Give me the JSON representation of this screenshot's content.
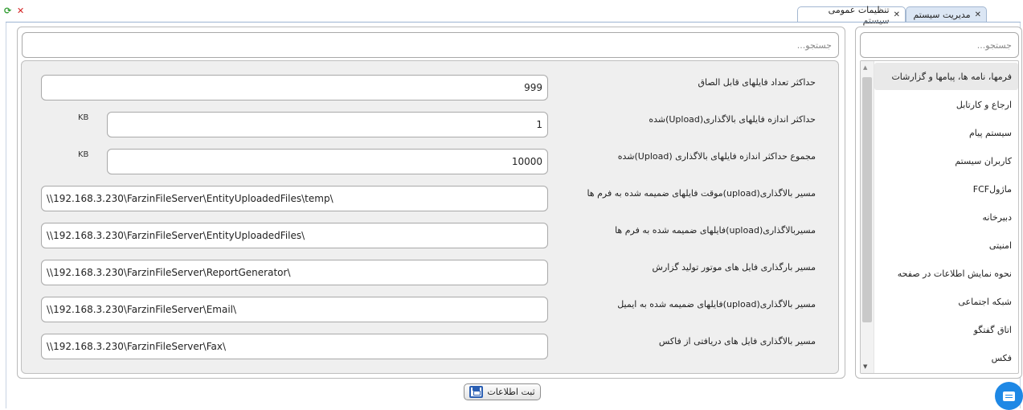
{
  "toolbar": {
    "refresh_icon": "refresh-icon",
    "close_icon": "close-icon"
  },
  "tabs": [
    {
      "label": "مدیریت سیستم",
      "active": false
    },
    {
      "label": "تنظیمات عمومی سیستم",
      "active": true
    }
  ],
  "sidebar": {
    "search_placeholder": "جستجو...",
    "items": [
      {
        "label": "فرمها، نامه ها، پیامها و گزارشات",
        "selected": true
      },
      {
        "label": "ارجاع و کارتابل"
      },
      {
        "label": "سیستم پیام"
      },
      {
        "label": "کاربران سیستم"
      },
      {
        "label": "ماژولFCF"
      },
      {
        "label": "دبیرخانه"
      },
      {
        "label": "امنیتی"
      },
      {
        "label": "نحوه نمایش اطلاعات در صفحه"
      },
      {
        "label": "شبکه اجتماعی"
      },
      {
        "label": "اتاق گفتگو"
      },
      {
        "label": "فکس"
      }
    ]
  },
  "main": {
    "search_placeholder": "جستجو...",
    "fields": [
      {
        "label": "حداکثر تعداد فایلهای قابل الصاق",
        "value": "999",
        "unit": ""
      },
      {
        "label": "حداکثر اندازه فایلهای بالاگذاری(Upload)شده",
        "value": "1",
        "unit": "KB"
      },
      {
        "label": "مجموع حداکثر اندازه فایلهای بالاگذاری (Upload)شده",
        "value": "10000",
        "unit": "KB"
      },
      {
        "label": "مسیر بالاگذاری(upload)موقت فایلهای ضمیمه شده به فرم ها",
        "value": "\\\\192.168.3.230\\FarzinFileServer\\EntityUploadedFiles\\temp\\"
      },
      {
        "label": "مسیربالاگذاری(upload)فایلهای ضمیمه شده به فرم ها",
        "value": "\\\\192.168.3.230\\FarzinFileServer\\EntityUploadedFiles\\"
      },
      {
        "label": "مسیر بارگذاری فایل های موتور تولید گزارش",
        "value": "\\\\192.168.3.230\\FarzinFileServer\\ReportGenerator\\"
      },
      {
        "label": "مسیر بالاگذاری(upload)فایلهای ضمیمه شده به ایمیل",
        "value": "\\\\192.168.3.230\\FarzinFileServer\\Email\\"
      },
      {
        "label": "مسیر بالاگذاری فایل های دریافتی از فاکس",
        "value": "\\\\192.168.3.230\\FarzinFileServer\\Fax\\"
      }
    ],
    "save_label": "ثبت اطلاعات"
  }
}
